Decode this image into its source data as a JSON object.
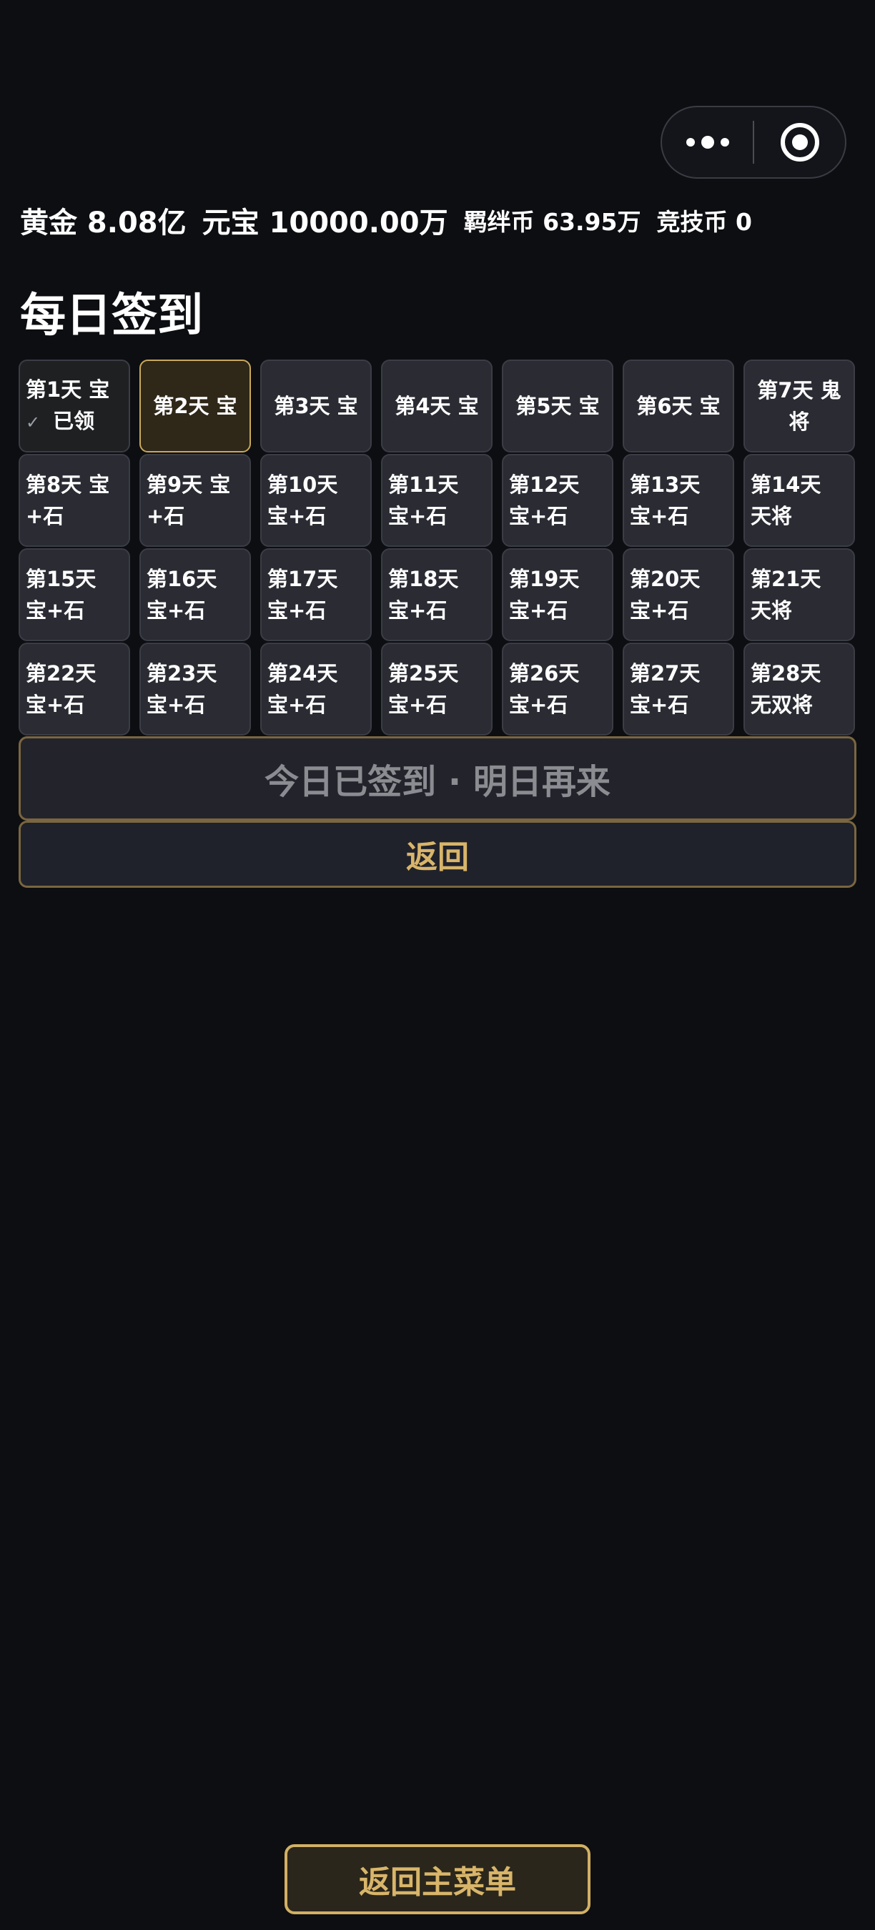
{
  "currencies": {
    "gold": "黄金 8.08亿",
    "yuanbao": "元宝 10000.00万",
    "bond": "羁绊币 63.95万",
    "arena": "竞技币 0"
  },
  "title": "每日签到",
  "days": [
    {
      "label": "第1天 宝",
      "status": "已领",
      "mark": "✓"
    },
    {
      "label": "第2天 宝"
    },
    {
      "label": "第3天 宝"
    },
    {
      "label": "第4天 宝"
    },
    {
      "label": "第5天 宝"
    },
    {
      "label": "第6天 宝"
    },
    {
      "label": "第7天 鬼将"
    },
    {
      "label": "第8天 宝+石"
    },
    {
      "label": "第9天 宝+石"
    },
    {
      "label": "第10天 宝+石"
    },
    {
      "label": "第11天 宝+石"
    },
    {
      "label": "第12天 宝+石"
    },
    {
      "label": "第13天 宝+石"
    },
    {
      "label": "第14天 天将"
    },
    {
      "label": "第15天 宝+石"
    },
    {
      "label": "第16天 宝+石"
    },
    {
      "label": "第17天 宝+石"
    },
    {
      "label": "第18天 宝+石"
    },
    {
      "label": "第19天 宝+石"
    },
    {
      "label": "第20天 宝+石"
    },
    {
      "label": "第21天 天将"
    },
    {
      "label": "第22天 宝+石"
    },
    {
      "label": "第23天 宝+石"
    },
    {
      "label": "第24天 宝+石"
    },
    {
      "label": "第25天 宝+石"
    },
    {
      "label": "第26天 宝+石"
    },
    {
      "label": "第27天 宝+石"
    },
    {
      "label": "第28天 无双将"
    }
  ],
  "buttons": {
    "signed": "今日已签到 · 明日再来",
    "back": "返回",
    "main_menu": "返回主菜单"
  },
  "colors": {
    "accent_gold": "#d8b56a",
    "background": "#0d0e12",
    "cell": "#2a2b33"
  },
  "icons": {
    "more": "more-dots-icon",
    "close": "target-circle-icon"
  }
}
